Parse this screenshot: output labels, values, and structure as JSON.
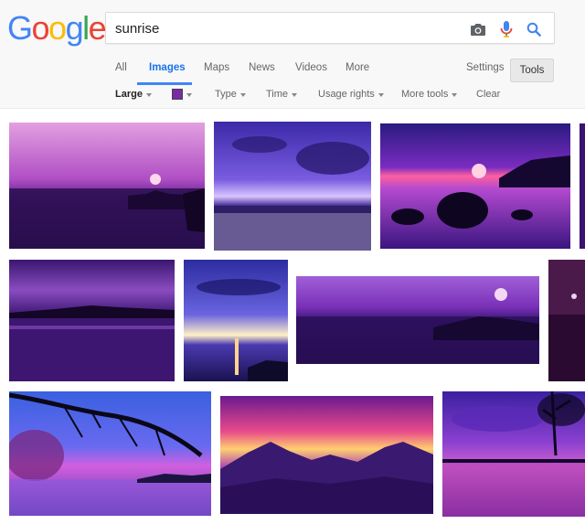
{
  "logo": {
    "letters": [
      "G",
      "o",
      "o",
      "g",
      "l",
      "e"
    ],
    "colors": [
      "#4285f4",
      "#ea4335",
      "#fbbc05",
      "#4285f4",
      "#34a853",
      "#ea4335"
    ]
  },
  "search": {
    "query": "sunrise"
  },
  "icons": {
    "camera": "camera-icon",
    "mic": "microphone-icon",
    "search": "search-icon"
  },
  "tabs": [
    "All",
    "Images",
    "Maps",
    "News",
    "Videos",
    "More"
  ],
  "active_tab": "Images",
  "right_tabs": {
    "settings": "Settings",
    "tools": "Tools"
  },
  "filters": {
    "size": "Large",
    "color_value": "#7b2aa6",
    "type": "Type",
    "time": "Time",
    "usage": "Usage rights",
    "more_tools": "More tools",
    "clear": "Clear"
  },
  "accent_color": "#4285f4",
  "results": {
    "row1": [
      "sunrise image 1",
      "sunrise image 2",
      "sunrise image 3",
      "sunrise image 4"
    ],
    "row2": [
      "sunrise image 5",
      "sunrise image 6",
      "sunrise image 7",
      "sunrise image 8"
    ],
    "row3": [
      "sunrise image 9",
      "sunrise image 10",
      "sunrise image 11"
    ]
  }
}
